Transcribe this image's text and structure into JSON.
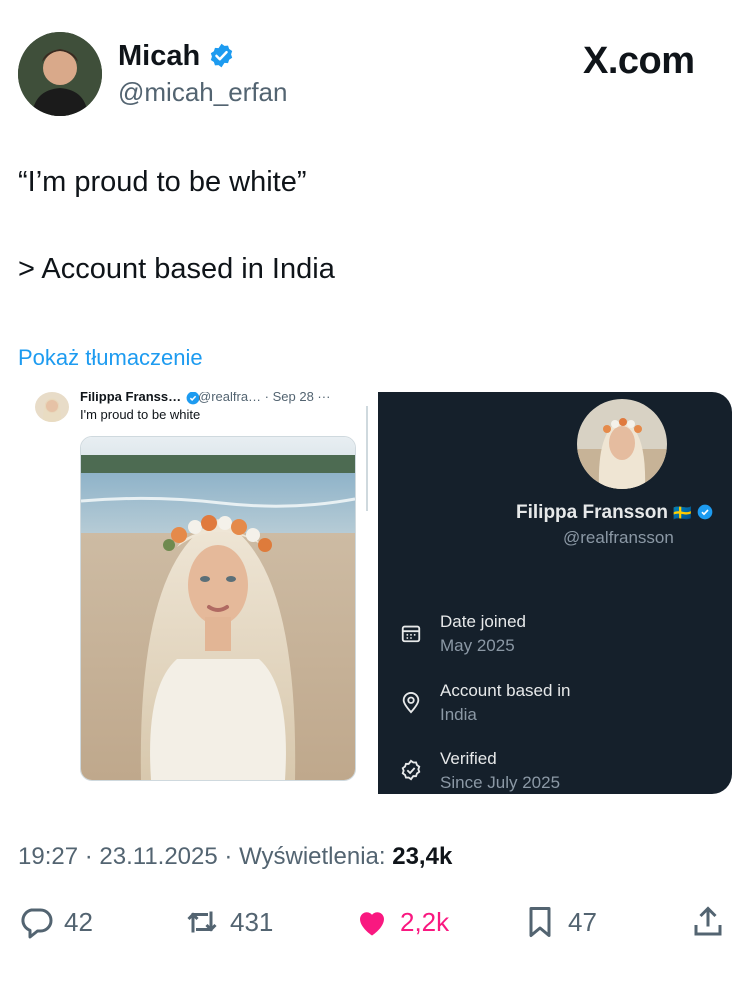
{
  "author": {
    "name": "Micah",
    "handle": "@micah_erfan"
  },
  "site_logo": "X.com",
  "tweet": {
    "line1": "“I’m proud to be white”",
    "line2": "> Account based in India",
    "translate_label": "Pokaż tłumaczenie"
  },
  "embedded_tweet": {
    "name": "Filippa Franss…",
    "meta": "@realfra… · Sep 28 ···",
    "text": "I'm proud to be white"
  },
  "profile_card": {
    "name": "Filippa Fransson",
    "flag": "🇸🇪",
    "handle": "@realfransson",
    "rows": [
      {
        "icon": "calendar-icon",
        "title": "Date joined",
        "value": "May 2025"
      },
      {
        "icon": "location-pin-icon",
        "title": "Account based in",
        "value": "India"
      },
      {
        "icon": "verified-badge-icon",
        "title": "Verified",
        "value": "Since July 2025"
      }
    ]
  },
  "meta": {
    "time": "19:27",
    "date": "23.11.2025",
    "views_label": "Wyświetlenia:",
    "views": "23,4k"
  },
  "actions": {
    "replies": "42",
    "reposts": "431",
    "likes": "2,2k",
    "bookmarks": "47"
  },
  "colors": {
    "accent": "#1d9bf0",
    "like": "#f91880",
    "card_bg": "#15202b"
  }
}
